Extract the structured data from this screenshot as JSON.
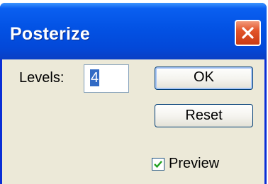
{
  "window": {
    "title": "Posterize",
    "close_icon": "close-icon"
  },
  "levels": {
    "label": "Levels:",
    "value": "4"
  },
  "buttons": {
    "ok_label": "OK",
    "reset_label": "Reset"
  },
  "preview": {
    "label": "Preview",
    "checked": true
  },
  "colors": {
    "titlebar": "#0352e4",
    "close_button": "#e2542a",
    "dialog_background": "#ece9d8",
    "selection": "#316ac5"
  }
}
